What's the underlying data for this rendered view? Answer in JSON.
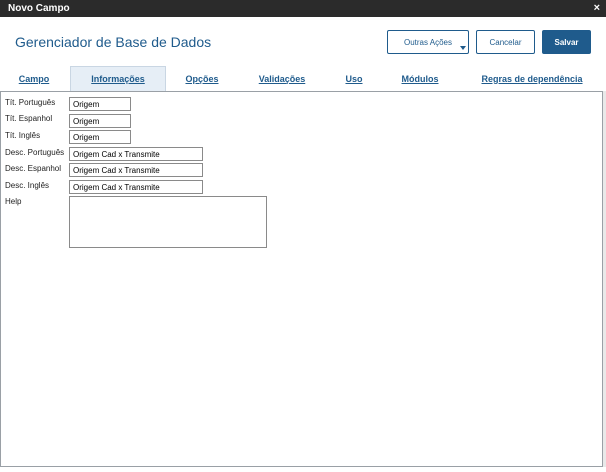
{
  "window": {
    "title": "Novo Campo",
    "close_glyph": "×"
  },
  "header": {
    "title": "Gerenciador de Base de Dados"
  },
  "toolbar": {
    "outras_acoes": "Outras Ações",
    "cancelar": "Cancelar",
    "salvar": "Salvar"
  },
  "tabs": [
    {
      "label": "Campo",
      "active": false
    },
    {
      "label": "Informações",
      "active": true
    },
    {
      "label": "Opções",
      "active": false
    },
    {
      "label": "Validações",
      "active": false
    },
    {
      "label": "Uso",
      "active": false
    },
    {
      "label": "Módulos",
      "active": false
    },
    {
      "label": "Regras de dependência",
      "active": false
    }
  ],
  "form": {
    "titulo_portugues": {
      "label": "Tít. Português",
      "value": "Origem"
    },
    "titulo_espanhol": {
      "label": "Tít. Espanhol",
      "value": "Origem"
    },
    "titulo_ingles": {
      "label": "Tít. Inglês",
      "value": "Origem"
    },
    "desc_portugues": {
      "label": "Desc. Português",
      "value": "Origem Cad x Transmite"
    },
    "desc_espanhol": {
      "label": "Desc. Espanhol",
      "value": "Origem Cad x Transmite"
    },
    "desc_ingles": {
      "label": "Desc. Inglês",
      "value": "Origem Cad x Transmite"
    },
    "help": {
      "label": "Help",
      "value": ""
    }
  },
  "colors": {
    "accent": "#1f5b8c",
    "titlebar": "#2b2b2b",
    "active_tab": "#e6eef6"
  }
}
